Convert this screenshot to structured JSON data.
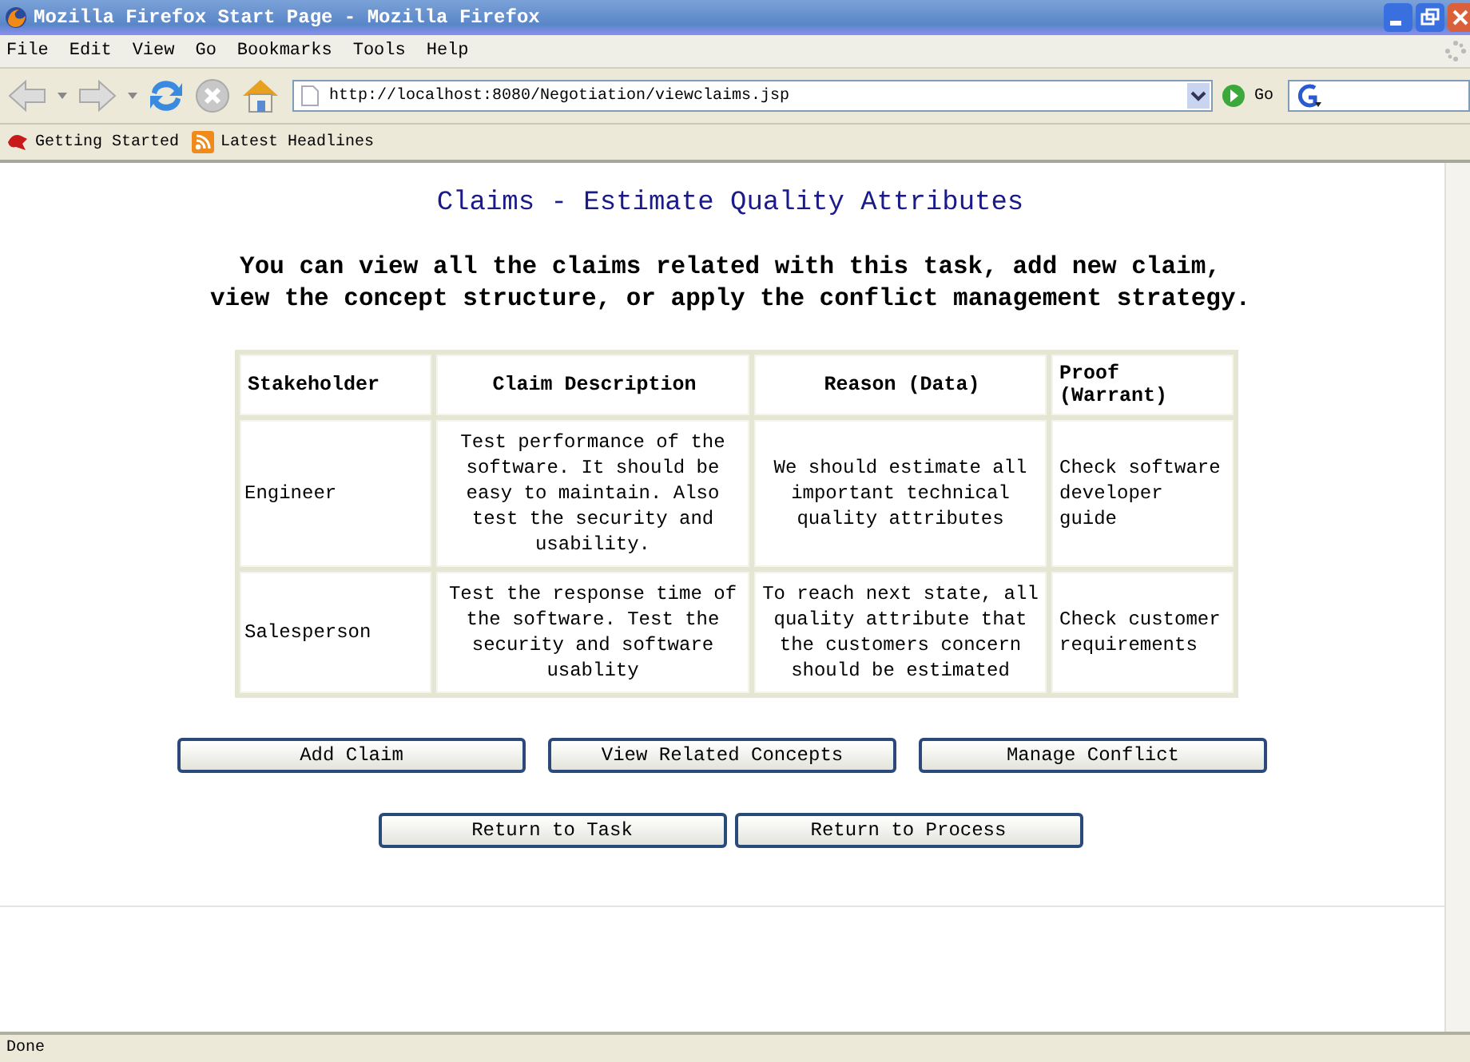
{
  "window": {
    "title": "Mozilla Firefox Start Page - Mozilla Firefox"
  },
  "menu": [
    "File",
    "Edit",
    "View",
    "Go",
    "Bookmarks",
    "Tools",
    "Help"
  ],
  "address_bar": {
    "value": "http://localhost:8080/Negotiation/viewclaims.jsp",
    "go_label": "Go"
  },
  "bookmarks": [
    "Getting Started",
    "Latest Headlines"
  ],
  "page": {
    "heading": "Claims - Estimate Quality Attributes",
    "intro": [
      "You can view all the claims related with this task, add new claim,",
      "view the concept structure, or apply the conflict management strategy."
    ],
    "table": {
      "columns": [
        "Stakeholder",
        "Claim Description",
        "Reason (Data)",
        "Proof (Warrant)"
      ],
      "rows": [
        [
          "Engineer",
          "Test performance of the software. It should be easy to maintain. Also test the security and usability.",
          "We should estimate all important technical quality attributes",
          "Check software developer guide"
        ],
        [
          "Salesperson",
          "Test the response time of the software. Test the security and software usablity",
          "To reach next state, all quality attribute that the customers concern should be estimated",
          "Check customer requirements"
        ]
      ]
    },
    "button_rows": [
      [
        "Add Claim",
        "View Related Concepts",
        "Manage Conflict"
      ],
      [
        "Return to Task",
        "Return to Process"
      ]
    ]
  },
  "status_bar": "Done"
}
